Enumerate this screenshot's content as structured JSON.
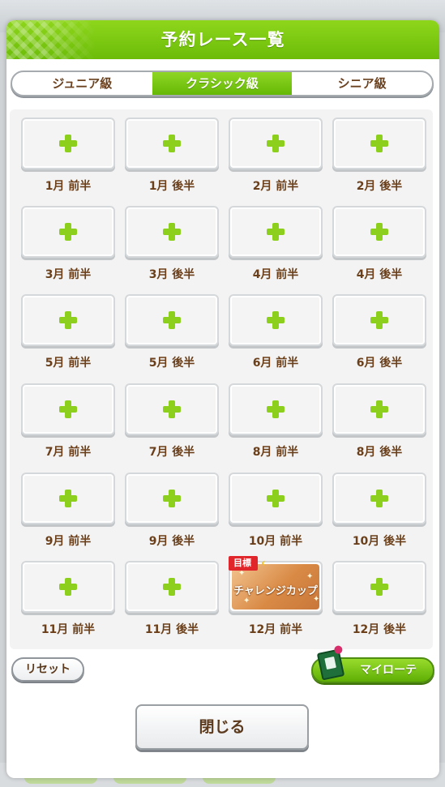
{
  "header": {
    "title": "予約レース一覧"
  },
  "tabs": [
    {
      "label": "ジュニア級",
      "active": false
    },
    {
      "label": "クラシック級",
      "active": true
    },
    {
      "label": "シニア級",
      "active": false
    }
  ],
  "slots": [
    {
      "label": "1月 前半",
      "type": "empty"
    },
    {
      "label": "1月 後半",
      "type": "empty"
    },
    {
      "label": "2月 前半",
      "type": "empty"
    },
    {
      "label": "2月 後半",
      "type": "empty"
    },
    {
      "label": "3月 前半",
      "type": "empty"
    },
    {
      "label": "3月 後半",
      "type": "empty"
    },
    {
      "label": "4月 前半",
      "type": "empty"
    },
    {
      "label": "4月 後半",
      "type": "empty"
    },
    {
      "label": "5月 前半",
      "type": "empty"
    },
    {
      "label": "5月 後半",
      "type": "empty"
    },
    {
      "label": "6月 前半",
      "type": "empty"
    },
    {
      "label": "6月 後半",
      "type": "empty"
    },
    {
      "label": "7月 前半",
      "type": "empty"
    },
    {
      "label": "7月 後半",
      "type": "empty"
    },
    {
      "label": "8月 前半",
      "type": "empty"
    },
    {
      "label": "8月 後半",
      "type": "empty"
    },
    {
      "label": "9月 前半",
      "type": "empty"
    },
    {
      "label": "9月 後半",
      "type": "empty"
    },
    {
      "label": "10月 前半",
      "type": "empty"
    },
    {
      "label": "10月 後半",
      "type": "empty"
    },
    {
      "label": "11月 前半",
      "type": "empty"
    },
    {
      "label": "11月 後半",
      "type": "empty"
    },
    {
      "label": "12月 前半",
      "type": "race",
      "race_name": "チャレンジカップ",
      "goal_tag": "目標"
    },
    {
      "label": "12月 後半",
      "type": "empty"
    }
  ],
  "buttons": {
    "reset": "リセット",
    "my_rotation": "マイローテ",
    "close": "閉じる"
  },
  "colors": {
    "accent_green": "#7ac70f",
    "label_brown": "#6b3f19",
    "goal_red": "#e0262a"
  }
}
